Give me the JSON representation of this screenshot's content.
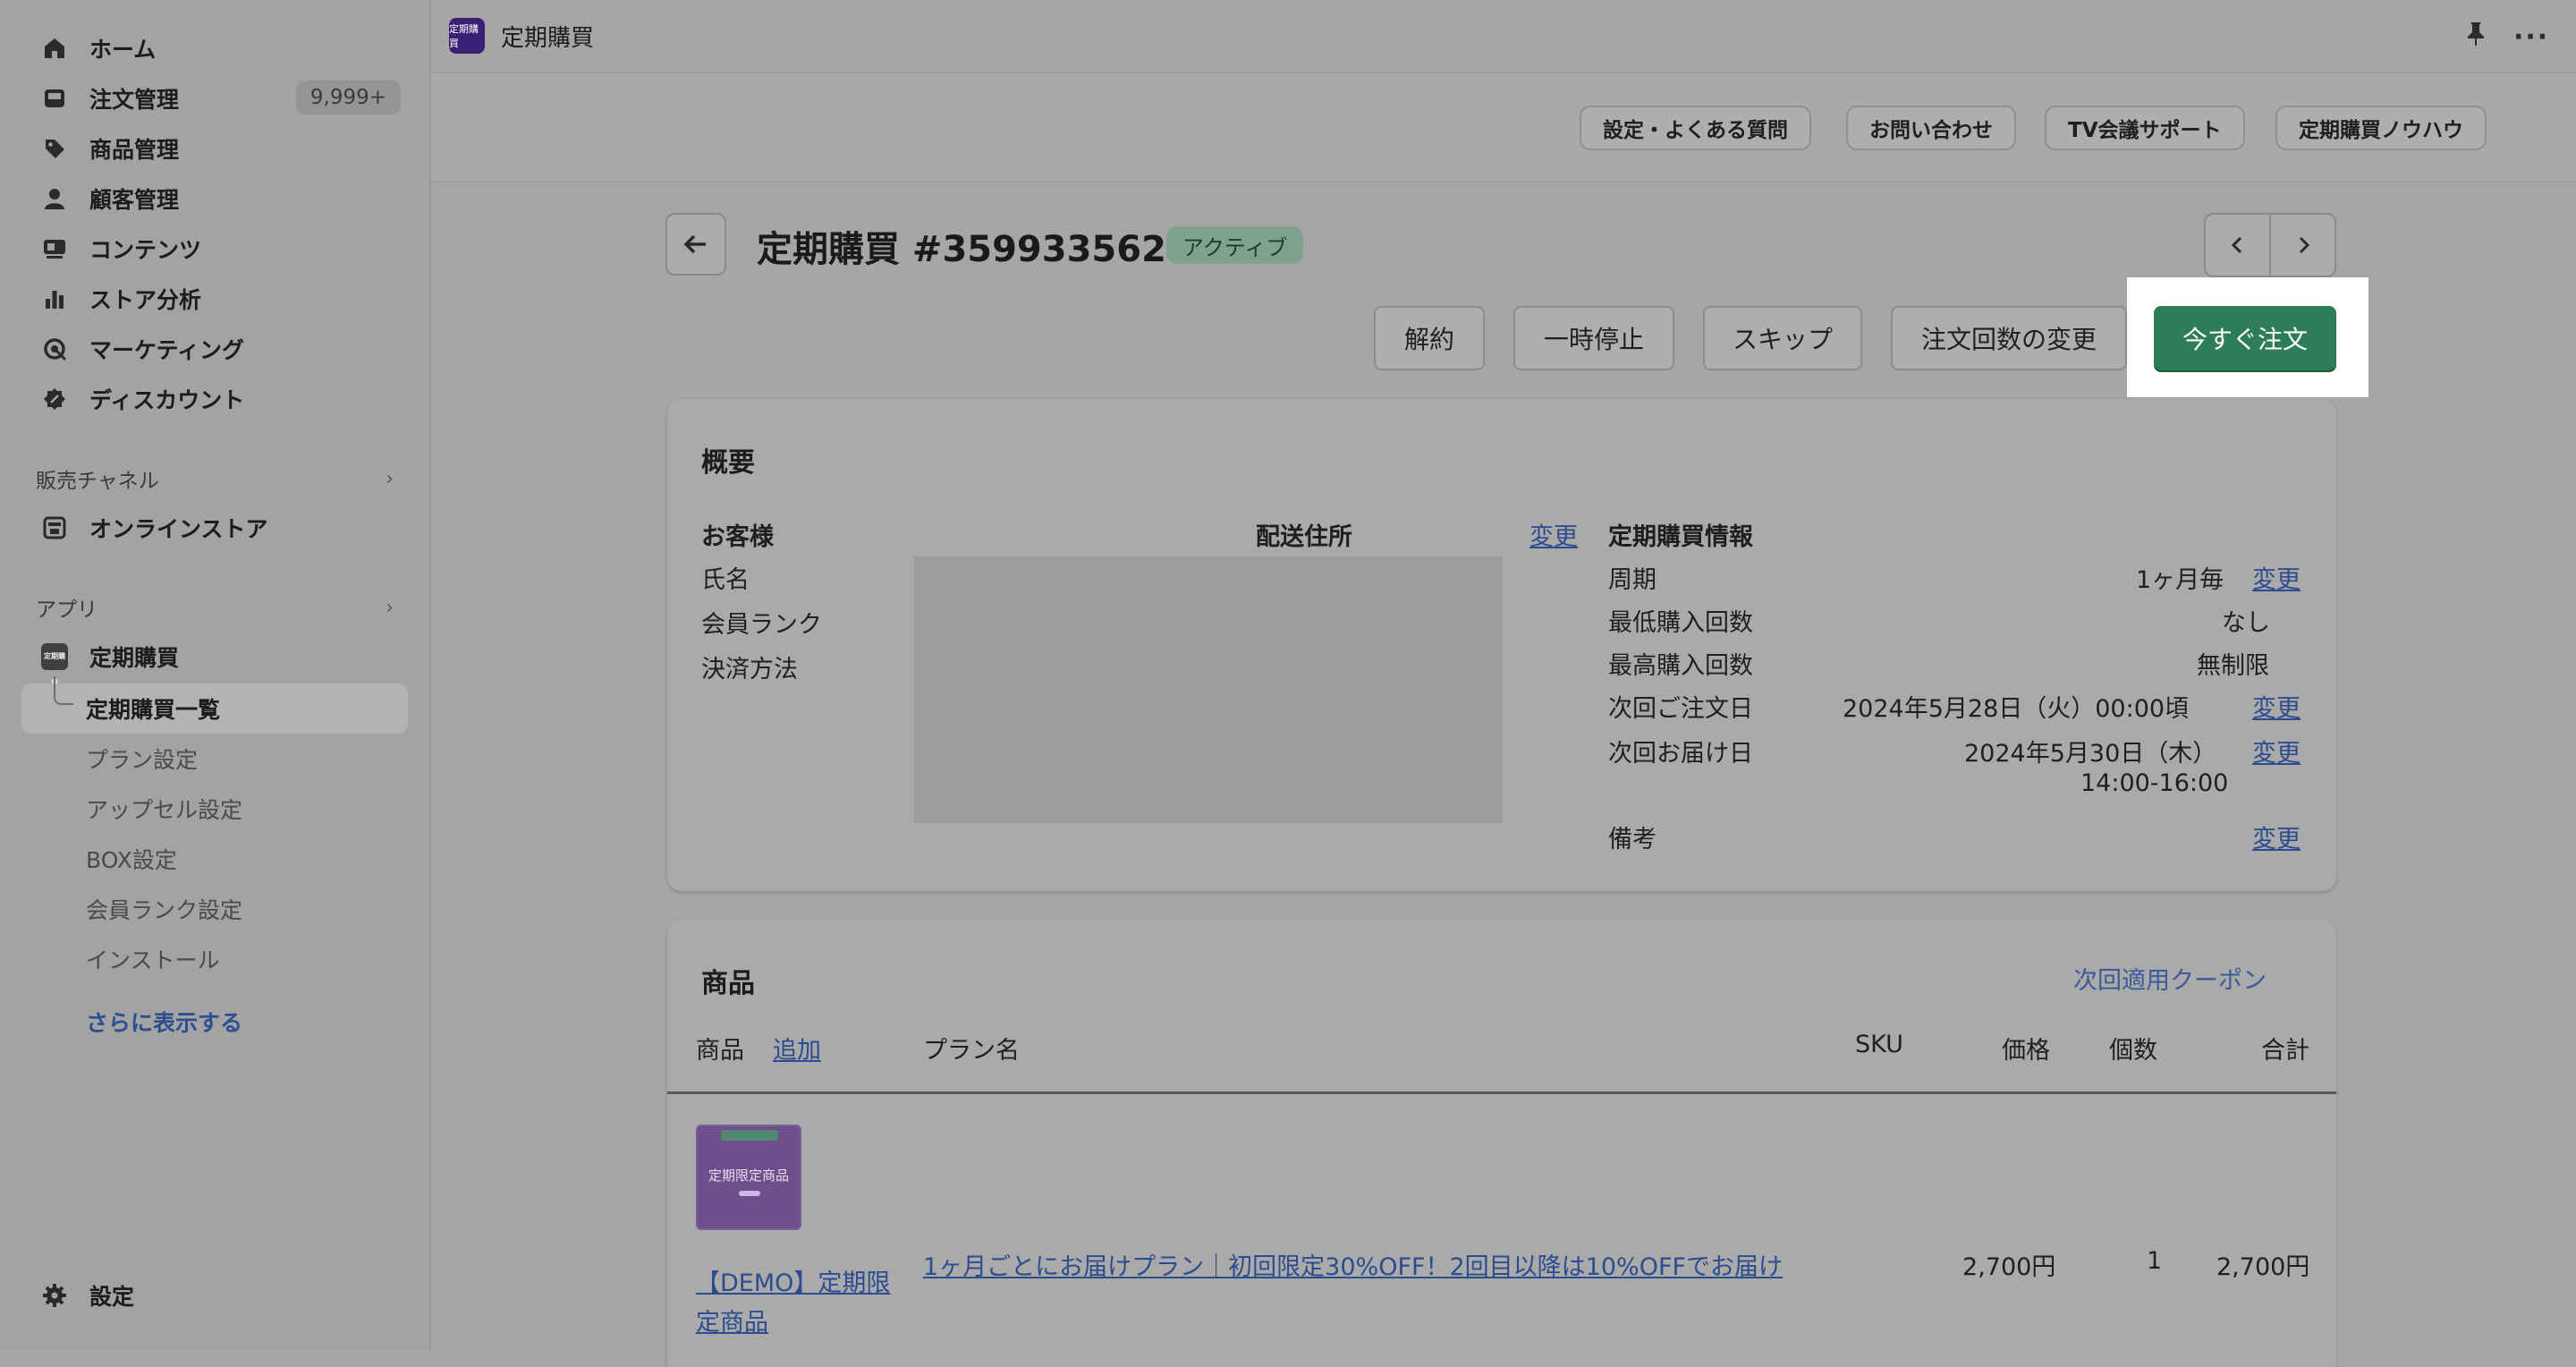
{
  "sidebar": {
    "items": [
      {
        "label": "ホーム",
        "icon": "home-icon"
      },
      {
        "label": "注文管理",
        "icon": "inbox-icon",
        "badge": "9,999+"
      },
      {
        "label": "商品管理",
        "icon": "tag-icon"
      },
      {
        "label": "顧客管理",
        "icon": "person-icon"
      },
      {
        "label": "コンテンツ",
        "icon": "content-icon"
      },
      {
        "label": "ストア分析",
        "icon": "bar-chart-icon"
      },
      {
        "label": "マーケティング",
        "icon": "target-icon"
      },
      {
        "label": "ディスカウント",
        "icon": "discount-icon"
      }
    ],
    "sales_channel_title": "販売チャネル",
    "online_store": "オンラインストア",
    "apps_title": "アプリ",
    "app_name": "定期購買",
    "app_sub_items": [
      "定期購買一覧",
      "プラン設定",
      "アップセル設定",
      "BOX設定",
      "会員ランク設定",
      "インストール"
    ],
    "more": "さらに表示する",
    "settings": "設定"
  },
  "topbar": {
    "app_logo_text": "定期購買",
    "title": "定期購買"
  },
  "help_buttons": [
    "設定・よくある質問",
    "お問い合わせ",
    "TV会議サポート",
    "定期購買ノウハウ"
  ],
  "header": {
    "title": "定期購買 #3599335629",
    "status": "アクティブ"
  },
  "actions": {
    "cancel": "解約",
    "pause": "一時停止",
    "skip": "スキップ",
    "change_count": "注文回数の変更",
    "order_now": "今すぐ注文"
  },
  "overview": {
    "title": "概要",
    "customer_heading": "お客様",
    "customer_fields": [
      "氏名",
      "会員ランク",
      "決済方法"
    ],
    "shipping_heading": "配送住所",
    "shipping_change": "変更",
    "info_heading": "定期購買情報",
    "rows": [
      {
        "label": "周期",
        "value": "1ヶ月毎",
        "action": "変更"
      },
      {
        "label": "最低購入回数",
        "value": "なし",
        "action": ""
      },
      {
        "label": "最高購入回数",
        "value": "無制限",
        "action": ""
      },
      {
        "label": "次回ご注文日",
        "value": "2024年5月28日（火）00:00頃",
        "action": "変更"
      },
      {
        "label": "次回お届け日",
        "value": "2024年5月30日（木）",
        "value2": "14:00-16:00",
        "action": "変更"
      },
      {
        "label": "備考",
        "value": "",
        "action": "変更"
      }
    ]
  },
  "products": {
    "title": "商品",
    "coupon_link": "次回適用クーポン",
    "headers": {
      "product": "商品",
      "add": "追加",
      "plan": "プラン名",
      "sku": "SKU",
      "price": "価格",
      "qty": "個数",
      "total": "合計"
    },
    "rows": [
      {
        "thumb_text": "定期限定商品",
        "name_line1": "【DEMO】定期限",
        "name_line2": "定商品",
        "plan": "1ヶ月ごとにお届けプラン｜初回限定30%OFF！2回目以降は10%OFFでお届け",
        "sku": "",
        "price": "2,700円",
        "qty": "1",
        "total": "2,700円"
      }
    ]
  }
}
